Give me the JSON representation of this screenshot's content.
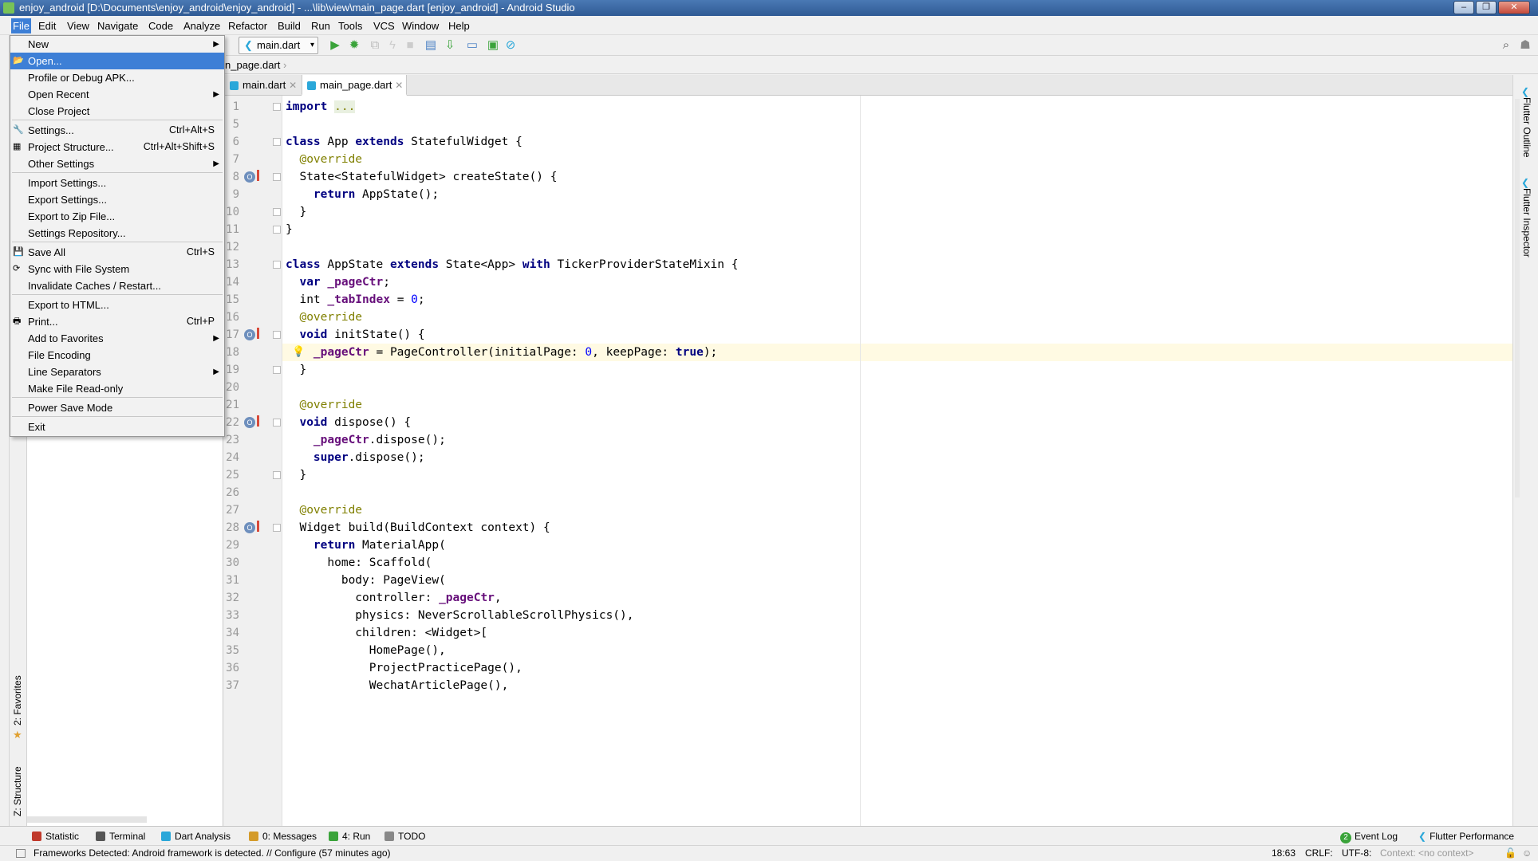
{
  "window": {
    "title": "enjoy_android [D:\\Documents\\enjoy_android\\enjoy_android] - ...\\lib\\view\\main_page.dart [enjoy_android] - Android Studio"
  },
  "menubar": [
    "File",
    "Edit",
    "View",
    "Navigate",
    "Code",
    "Analyze",
    "Refactor",
    "Build",
    "Run",
    "Tools",
    "VCS",
    "Window",
    "Help"
  ],
  "toolbar": {
    "run_config": "main.dart"
  },
  "breadcrumb": "n_page.dart",
  "tabs": [
    {
      "label": "main.dart",
      "active": false
    },
    {
      "label": "main_page.dart",
      "active": true
    }
  ],
  "file_menu": [
    {
      "label": "New",
      "shortcut": "",
      "submenu": true,
      "icon": ""
    },
    {
      "label": "Open...",
      "shortcut": "",
      "submenu": false,
      "icon": "folder-icon",
      "highlighted": true
    },
    {
      "label": "Profile or Debug APK...",
      "shortcut": "",
      "submenu": false,
      "icon": ""
    },
    {
      "label": "Open Recent",
      "shortcut": "",
      "submenu": true,
      "icon": ""
    },
    {
      "label": "Close Project",
      "shortcut": "",
      "submenu": false,
      "icon": ""
    },
    {
      "label": "Settings...",
      "shortcut": "Ctrl+Alt+S",
      "submenu": false,
      "icon": "settings-icon"
    },
    {
      "label": "Project Structure...",
      "shortcut": "Ctrl+Alt+Shift+S",
      "submenu": false,
      "icon": "project-structure-icon"
    },
    {
      "label": "Other Settings",
      "shortcut": "",
      "submenu": true,
      "icon": ""
    },
    {
      "label": "Import Settings...",
      "shortcut": "",
      "submenu": false,
      "icon": ""
    },
    {
      "label": "Export Settings...",
      "shortcut": "",
      "submenu": false,
      "icon": ""
    },
    {
      "label": "Export to Zip File...",
      "shortcut": "",
      "submenu": false,
      "icon": ""
    },
    {
      "label": "Settings Repository...",
      "shortcut": "",
      "submenu": false,
      "icon": ""
    },
    {
      "label": "Save All",
      "shortcut": "Ctrl+S",
      "submenu": false,
      "icon": "save-icon"
    },
    {
      "label": "Sync with File System",
      "shortcut": "",
      "submenu": false,
      "icon": "sync-icon"
    },
    {
      "label": "Invalidate Caches / Restart...",
      "shortcut": "",
      "submenu": false,
      "icon": ""
    },
    {
      "label": "Export to HTML...",
      "shortcut": "",
      "submenu": false,
      "icon": ""
    },
    {
      "label": "Print...",
      "shortcut": "Ctrl+P",
      "submenu": false,
      "icon": "print-icon"
    },
    {
      "label": "Add to Favorites",
      "shortcut": "",
      "submenu": true,
      "icon": ""
    },
    {
      "label": "File Encoding",
      "shortcut": "",
      "submenu": false,
      "icon": ""
    },
    {
      "label": "Line Separators",
      "shortcut": "",
      "submenu": true,
      "icon": ""
    },
    {
      "label": "Make File Read-only",
      "shortcut": "",
      "submenu": false,
      "icon": ""
    },
    {
      "label": "Power Save Mode",
      "shortcut": "",
      "submenu": false,
      "icon": ""
    },
    {
      "label": "Exit",
      "shortcut": "",
      "submenu": false,
      "icon": ""
    }
  ],
  "editor": {
    "lines": [
      {
        "n": "1",
        "code": "import ..."
      },
      {
        "n": "5",
        "code": ""
      },
      {
        "n": "6",
        "code": "class App extends StatefulWidget {"
      },
      {
        "n": "7",
        "code": "  @override"
      },
      {
        "n": "8",
        "code": "  State<StatefulWidget> createState() {"
      },
      {
        "n": "9",
        "code": "    return AppState();"
      },
      {
        "n": "10",
        "code": "  }"
      },
      {
        "n": "11",
        "code": "}"
      },
      {
        "n": "12",
        "code": ""
      },
      {
        "n": "13",
        "code": "class AppState extends State<App> with TickerProviderStateMixin {"
      },
      {
        "n": "14",
        "code": "  var _pageCtr;"
      },
      {
        "n": "15",
        "code": "  int _tabIndex = 0;"
      },
      {
        "n": "16",
        "code": "  @override"
      },
      {
        "n": "17",
        "code": "  void initState() {"
      },
      {
        "n": "18",
        "code": "    _pageCtr = PageController(initialPage: 0, keepPage: true);"
      },
      {
        "n": "19",
        "code": "  }"
      },
      {
        "n": "20",
        "code": ""
      },
      {
        "n": "21",
        "code": "  @override"
      },
      {
        "n": "22",
        "code": "  void dispose() {"
      },
      {
        "n": "23",
        "code": "    _pageCtr.dispose();"
      },
      {
        "n": "24",
        "code": "    super.dispose();"
      },
      {
        "n": "25",
        "code": "  }"
      },
      {
        "n": "26",
        "code": ""
      },
      {
        "n": "27",
        "code": "  @override"
      },
      {
        "n": "28",
        "code": "  Widget build(BuildContext context) {"
      },
      {
        "n": "29",
        "code": "    return MaterialApp("
      },
      {
        "n": "30",
        "code": "      home: Scaffold("
      },
      {
        "n": "31",
        "code": "        body: PageView("
      },
      {
        "n": "32",
        "code": "          controller: _pageCtr,"
      },
      {
        "n": "33",
        "code": "          physics: NeverScrollableScrollPhysics(),"
      },
      {
        "n": "34",
        "code": "          children: <Widget>["
      },
      {
        "n": "35",
        "code": "            HomePage(),"
      },
      {
        "n": "36",
        "code": "            ProjectPracticePage(),"
      },
      {
        "n": "37",
        "code": "            WechatArticlePage(),"
      }
    ]
  },
  "left_tools": [
    "2: Favorites",
    "Z: Structure"
  ],
  "right_tools": [
    "Flutter Outline",
    "Flutter Inspector"
  ],
  "bottom_tools": [
    {
      "label": "Statistic",
      "color": "#c0392b"
    },
    {
      "label": "Terminal",
      "color": "#555555"
    },
    {
      "label": "Dart Analysis",
      "color": "#2aa7d9"
    },
    {
      "label": "0: Messages",
      "color": "#d49b2a"
    },
    {
      "label": "4: Run",
      "color": "#3aa33a"
    },
    {
      "label": "TODO",
      "color": "#888888"
    }
  ],
  "bottom_right_tools": [
    {
      "label": "Event Log",
      "badge": "2"
    },
    {
      "label": "Flutter Performance"
    }
  ],
  "statusbar": {
    "message": "Frameworks Detected: Android framework is detected. // Configure (57 minutes ago)",
    "position": "18:63",
    "line_sep": "CRLF:",
    "encoding": "UTF-8:",
    "context": "Context: <no context>"
  }
}
